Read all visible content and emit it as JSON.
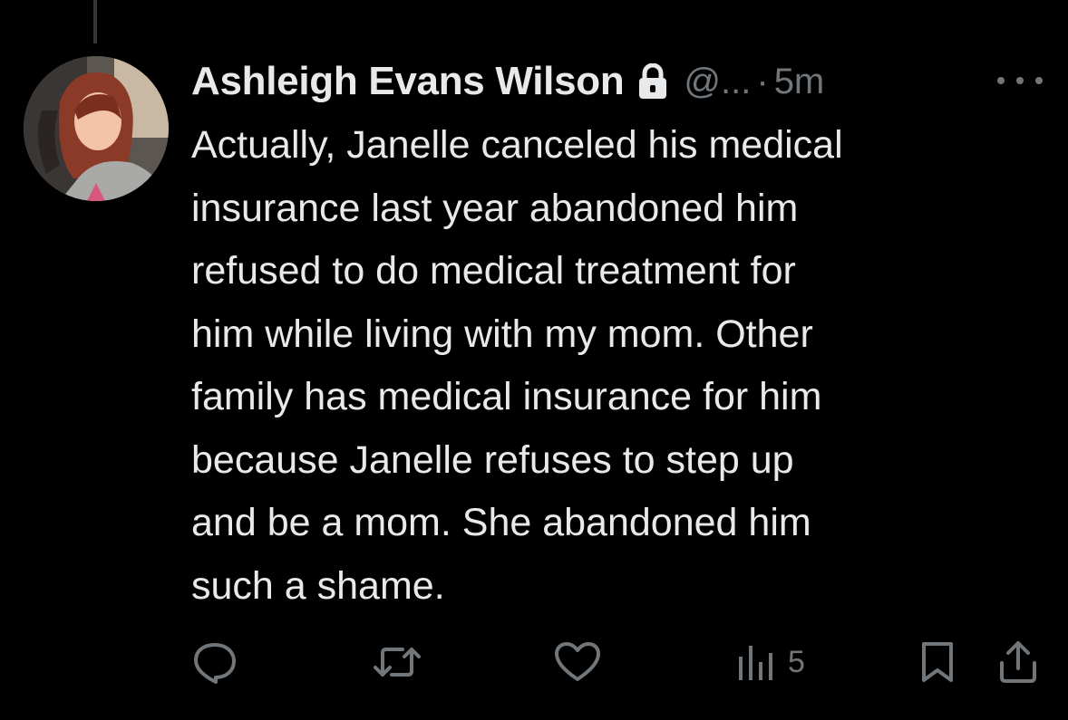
{
  "tweet": {
    "author": {
      "display_name": "Ashleigh Evans Wilson",
      "handle": "@...",
      "protected_icon": "lock-icon"
    },
    "separator": "·",
    "timestamp": "5m",
    "text_lines": [
      "Actually, Janelle canceled his medical",
      "insurance last year abandoned him",
      "refused to do medical treatment for",
      "him while living with my mom. Other",
      "family has medical insurance for him",
      "because Janelle refuses to step up",
      "and be a mom. She abandoned him",
      "such a shame."
    ],
    "actions": {
      "reply_icon": "reply-icon",
      "retweet_icon": "retweet-icon",
      "like_icon": "heart-icon",
      "views_icon": "views-icon",
      "views_count": "5",
      "bookmark_icon": "bookmark-icon",
      "share_icon": "share-icon"
    }
  },
  "colors": {
    "background": "#000000",
    "primary_text": "#e7e9ea",
    "secondary_text": "#71767b",
    "thread_line": "#333639"
  }
}
